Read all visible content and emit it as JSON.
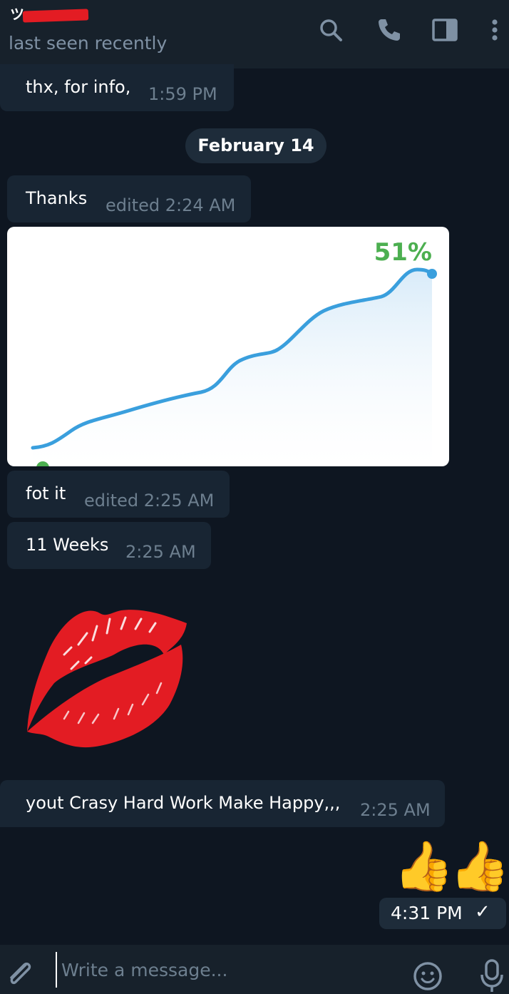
{
  "header": {
    "contact_name": "ツ",
    "status": "last seen recently",
    "icons": [
      "search-icon",
      "phone-icon",
      "sidebar-icon",
      "more-icon"
    ]
  },
  "messages": [
    {
      "text": "thx, for info,",
      "time": "1:59 PM"
    },
    {
      "text": "Thanks",
      "time": "edited 2:24 AM"
    },
    {
      "text": "fot it",
      "time": "edited 2:25 AM"
    },
    {
      "text": "11 Weeks",
      "time": "2:25 AM"
    },
    {
      "text": "yout Crasy Hard Work Make Happy,,,",
      "time": "2:25 AM"
    }
  ],
  "date_separator": "February 14",
  "chart_image": {
    "label": "51%",
    "line_color": "#3a9fdd",
    "label_color": "#4caf50"
  },
  "stickers": {
    "kiss": "red-lips-sticker",
    "thumbs": "👍👍"
  },
  "outgoing": {
    "time": "4:31 PM",
    "check": "✓"
  },
  "composer": {
    "placeholder": "Write a message..."
  }
}
